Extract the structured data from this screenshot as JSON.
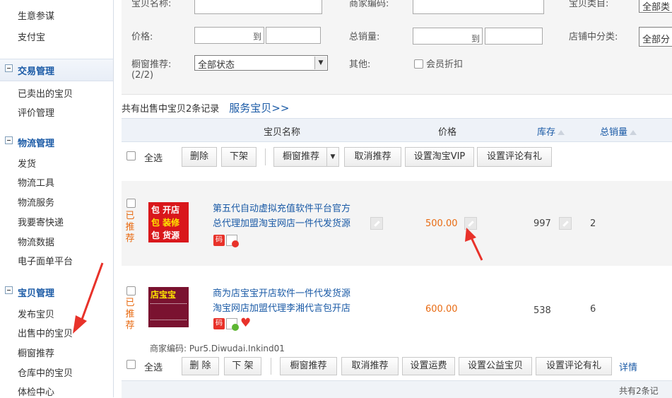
{
  "sidebar": {
    "top_items": [
      "生意参谋",
      "支付宝"
    ],
    "sections": [
      {
        "title": "交易管理",
        "items": [
          "已卖出的宝贝",
          "评价管理"
        ]
      },
      {
        "title": "物流管理",
        "items": [
          "发货",
          "物流工具",
          "物流服务",
          "我要寄快递",
          "物流数据",
          "电子面单平台"
        ]
      },
      {
        "title": "宝贝管理",
        "items": [
          "发布宝贝",
          "出售中的宝贝",
          "橱窗推荐",
          "仓库中的宝贝",
          "体检中心"
        ]
      }
    ]
  },
  "filters": {
    "row0": {
      "name_label": "宝贝名称:",
      "merchant_code_label": "商家编码:",
      "type_label": "宝贝类目:",
      "type_value": "全部类"
    },
    "price_label": "价格:",
    "to_label": "到",
    "total_sales_label": "总销量:",
    "shop_category_label": "店铺中分类:",
    "shop_category_value": "全部分",
    "window_label": "橱窗推荐:",
    "window_count": "(2/2)",
    "window_value": "全部状态",
    "other_label": "其他:",
    "member_discount_label": "会员折扣"
  },
  "summary": {
    "text": "共有出售中宝贝2条记录",
    "service_link": "服务宝贝>>"
  },
  "table_header": {
    "name": "宝贝名称",
    "price": "价格",
    "stock": "库存",
    "sales": "总销量"
  },
  "toolbar_top": {
    "select_all": "全选",
    "delete": "删除",
    "off_shelf": "下架",
    "window_recommend": "橱窗推荐",
    "cancel_recommend": "取消推荐",
    "set_vip": "设置淘宝VIP",
    "set_review_gift": "设置评论有礼"
  },
  "products": [
    {
      "recommended_label": "已推荐",
      "thumb_lines": [
        "包 开店",
        "包 装修",
        "包 货源"
      ],
      "title_lines": [
        "第五代自动虚拟充值软件平台官方",
        "总代理加盟淘宝网店一件代发货源"
      ],
      "price": "500.00",
      "stock": "997",
      "sales": "2",
      "badge_code": "码"
    },
    {
      "recommended_label": "已推荐",
      "thumb_lines": [
        "店宝宝"
      ],
      "title_lines": [
        "商为店宝宝开店软件一件代发货源",
        "淘宝网店加盟代理李湘代言包开店"
      ],
      "price": "600.00",
      "stock": "538",
      "sales": "6",
      "badge_code": "码",
      "merchant_code": "商家编码: Pur5.Diwudai.Inkind01"
    }
  ],
  "toolbar_bottom": {
    "select_all": "全选",
    "delete": "删 除",
    "off_shelf": "下 架",
    "window_recommend": "橱窗推荐",
    "cancel_recommend": "取消推荐",
    "set_shipping": "设置运费",
    "set_charity": "设置公益宝贝",
    "set_review_gift": "设置评论有礼",
    "details": "详情"
  },
  "footer": {
    "total": "共有2条记"
  },
  "colors": {
    "link": "#1a5aa6",
    "price": "#e86b13",
    "arrow": "#e8322a",
    "thumb_red": "#d9171b"
  }
}
